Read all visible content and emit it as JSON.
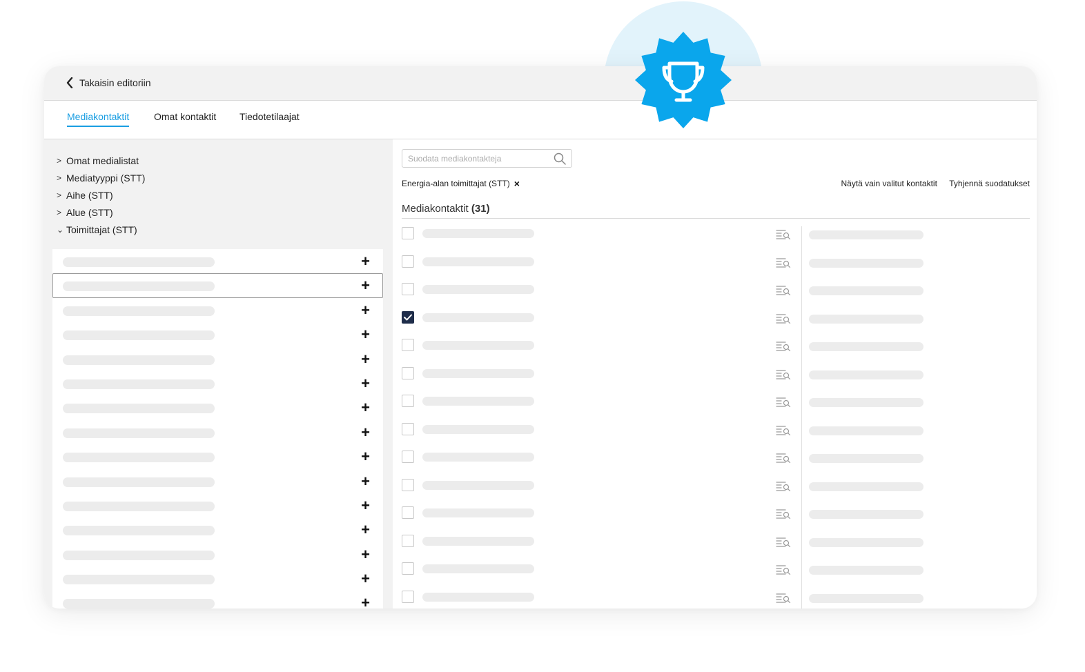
{
  "header": {
    "back_label": "Takaisin editoriin"
  },
  "tabs": [
    {
      "label": "Mediakontaktit",
      "active": true
    },
    {
      "label": "Omat kontaktit",
      "active": false
    },
    {
      "label": "Tiedotetilaajat",
      "active": false
    }
  ],
  "sidebar": {
    "tree": [
      {
        "label": "Omat medialistat",
        "expanded": false
      },
      {
        "label": "Mediatyyppi (STT)",
        "expanded": false
      },
      {
        "label": "Aihe (STT)",
        "expanded": false
      },
      {
        "label": "Alue (STT)",
        "expanded": false
      },
      {
        "label": "Toimittajat (STT)",
        "expanded": true
      }
    ],
    "category_row_count": 15,
    "selected_row_index": 1,
    "add_glyph": "+"
  },
  "main": {
    "search_placeholder": "Suodata mediakontakteja",
    "active_filter": "Energia-alan toimittajat (STT)",
    "remove_filter_glyph": "×",
    "show_selected_label": "Näytä vain valitut kontaktit",
    "clear_filters_label": "Tyhjennä suodatukset",
    "section_title": "Mediakontaktit",
    "section_count": "(31)",
    "visible_rows": 14,
    "checked_row_index": 3
  },
  "icons": {
    "back": "chevron-left-icon",
    "search": "search-icon",
    "detail": "list-search-icon",
    "badge": "trophy-icon"
  },
  "colors": {
    "accent": "#1a9ee2",
    "badge": "#0aa6ec",
    "checkbox_checked": "#1f2d4a"
  }
}
